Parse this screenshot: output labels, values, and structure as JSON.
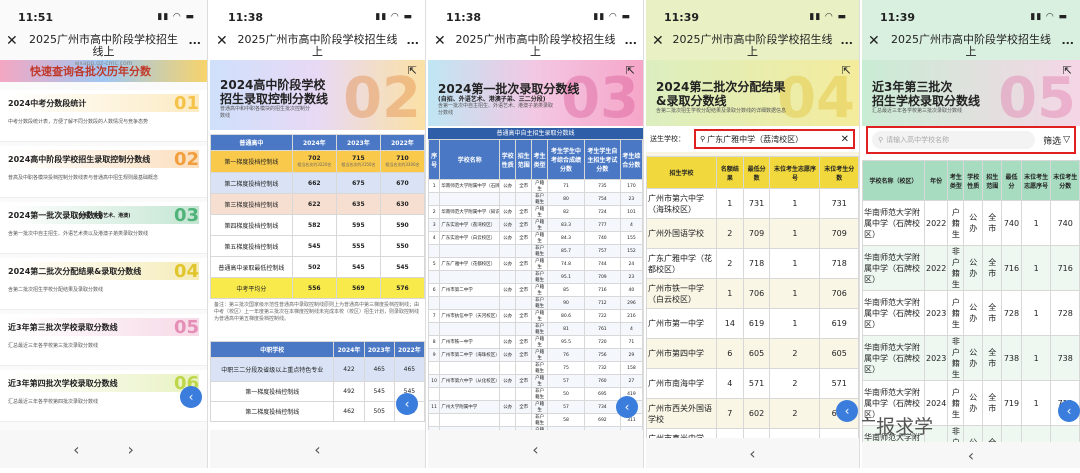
{
  "common": {
    "title": "2025广州市高中阶段学校招生线上",
    "domain": "wxapp.gz-cmc.com",
    "close": "✕",
    "more": "...",
    "signal": "▮▮ ◠ ▬",
    "prev": "‹",
    "next": "›",
    "fab": "‹"
  },
  "p1": {
    "time": "11:51",
    "banner": "快速查询各批次历年分数",
    "items": [
      {
        "title": "2024中考分数段统计",
        "num": "01",
        "desc": "中考分数段统计表，方便了解不同分数段的人数情况与竞争态势",
        "color": "#f6c34a"
      },
      {
        "title": "2024高中阶段学校招生录取控制分数线",
        "num": "02",
        "desc": "普高及中职各模块投档控制分数线表与普通高中招生规则最基础概念",
        "color": "#f29e3d"
      },
      {
        "title": "2024第一批次录取分数线",
        "title_small": "(自招、外语艺术、港澳)",
        "num": "03",
        "desc": "含第一批次中自主招生、外语艺术类以及港澳子弟类录取分数线",
        "color": "#4fb37a"
      },
      {
        "title": "2024第二批次分配结果&录取分数线",
        "num": "04",
        "desc": "含第二批次招生学校分配结果及录取分数线",
        "color": "#e1c52c"
      },
      {
        "title": "近3年第三批次学校录取分数线",
        "num": "05",
        "desc": "汇总最近三年各学校第三批次录取分数线",
        "color": "#e58fb7"
      },
      {
        "title": "近3年第四批次学校录取分数线",
        "num": "06",
        "desc": "汇总最近三年各学校第四批次录取分数线",
        "color": "#bcd74a"
      }
    ]
  },
  "p2": {
    "time": "11:38",
    "h1": "2024高中阶段学校",
    "h2": "招生录取控制分数线",
    "sub1": "普通高中和中职各模块的招生批次控制分",
    "sub2": "数线",
    "big": "02",
    "headers": [
      "普通高中",
      "2024年",
      "2023年",
      "2022年"
    ],
    "rows": [
      {
        "name": "第一梯度投档控制线",
        "v": [
          "702",
          "715",
          "710"
        ],
        "n": [
          "相当名次约3220名",
          "相当名次约3150名",
          "相当名次约3300名"
        ],
        "bg": "#f9c94c"
      },
      {
        "name": "第二梯度投档控制线",
        "v": [
          "662",
          "675",
          "670"
        ],
        "bg": "#d9e3f5"
      },
      {
        "name": "第三梯度投档控制线",
        "v": [
          "622",
          "635",
          "630"
        ],
        "bg": "#f6dfd0"
      },
      {
        "name": "第四梯度投档控制线",
        "v": [
          "582",
          "595",
          "590"
        ],
        "bg": "#fff"
      },
      {
        "name": "第五梯度投档控制线",
        "v": [
          "545",
          "555",
          "550"
        ],
        "bg": "#fff"
      },
      {
        "name": "普通高中录取最低控制线",
        "v": [
          "502",
          "545",
          "545"
        ],
        "bg": "#fff"
      },
      {
        "name": "中考平均分",
        "v": [
          "556",
          "569",
          "576"
        ],
        "bg": "#f9ea4c"
      }
    ],
    "note": "备注：第三批次国家级示范性普通高中录取控制线原则上为普通高中第三梯度投档控制线；由中考（校区）上一年度第三批次在本梯度控制线未完成本校（校区）招生计划，则录取控制线为普通高中第五梯度投档控制线。",
    "headers2": [
      "中职学校",
      "2024年",
      "2023年",
      "2022年"
    ],
    "rows2": [
      {
        "name": "中职三二分段及省级以上重点特色专业",
        "v": [
          "422",
          "465",
          "465"
        ]
      },
      {
        "name": "第一梯度投档控制线",
        "v": [
          "492",
          "545",
          "545"
        ]
      },
      {
        "name": "第二梯度投档控制线",
        "v": [
          "462",
          "505",
          "505"
        ]
      }
    ]
  },
  "p3": {
    "time": "11:38",
    "h1": "2024第一批次录取分数线",
    "sub1": "(自招、外语艺术、港澳子弟、三二分段)",
    "sub2": "含第一批次中自主招生、外语艺术、港澳子弟类录取",
    "sub3": "分数线",
    "big": "03",
    "table_title": "普通高中自主招生录取分数线",
    "headers": [
      "序号",
      "学校名称",
      "学校性质",
      "招生范围",
      "考生类型",
      "考生学生中考综合成绩分数",
      "考生学生自主招生考试分数",
      "考生综合分数"
    ],
    "rows": [
      [
        "1",
        "华南师范大学附属中学（石牌校区）",
        "公办",
        "全市",
        "户籍生",
        "71",
        "735",
        "170"
      ],
      [
        "",
        "",
        "",
        "",
        "非户籍生",
        "80",
        "754",
        "23"
      ],
      [
        "2",
        "华南师范大学附属中学（知识城校区）",
        "公办",
        "全市",
        "户籍生",
        "82",
        "724",
        "101"
      ],
      [
        "3",
        "广东实验中学（荔湾校区）",
        "公办",
        "全市",
        "户籍生",
        "83.3",
        "777",
        "4"
      ],
      [
        "4",
        "广东实验中学（白云校区）",
        "公办",
        "全市",
        "户籍生",
        "84.3",
        "740",
        "155"
      ],
      [
        "",
        "",
        "",
        "",
        "非户籍生",
        "85.7",
        "757",
        "152"
      ],
      [
        "5",
        "广东广雅中学（花都校区）",
        "公办",
        "全市",
        "户籍生",
        "74.8",
        "744",
        "24"
      ],
      [
        "",
        "",
        "",
        "",
        "非户籍生",
        "95.1",
        "709",
        "23"
      ],
      [
        "6",
        "广州市第二中学",
        "公办",
        "全市",
        "户籍生",
        "85",
        "716",
        "40"
      ],
      [
        "",
        "",
        "",
        "",
        "非户籍生",
        "90",
        "712",
        "296"
      ],
      [
        "7",
        "广州市执信中学（天河校区）",
        "公办",
        "全市",
        "户籍生",
        "80.6",
        "722",
        "216"
      ],
      [
        "",
        "",
        "",
        "",
        "非户籍生",
        "81",
        "761",
        "4"
      ],
      [
        "8",
        "广州市铁一中学",
        "公办",
        "全市",
        "户籍生",
        "95.5",
        "720",
        "71"
      ],
      [
        "9",
        "广州市第二中学（海珠校区）",
        "公办",
        "全市",
        "户籍生",
        "76",
        "756",
        "29"
      ],
      [
        "",
        "",
        "",
        "",
        "非户籍生",
        "75",
        "732",
        "158"
      ],
      [
        "10",
        "广州市第六中学（从化校区）",
        "公办",
        "全市",
        "户籍生",
        "57",
        "760",
        "27"
      ],
      [
        "",
        "",
        "",
        "",
        "非户籍生",
        "50",
        "695",
        "419"
      ],
      [
        "11",
        "广州大学附属中学",
        "公办",
        "全市",
        "户籍生",
        "57",
        "734",
        "110"
      ],
      [
        "",
        "",
        "",
        "",
        "非户籍生",
        "58",
        "692",
        "311"
      ],
      [
        "12",
        "广州市第四中学",
        "公办",
        "全市",
        "户籍生",
        "50",
        "720",
        "99"
      ],
      [
        "",
        "",
        "",
        "",
        "非户籍生",
        "83.4",
        "697",
        "163"
      ]
    ]
  },
  "p4": {
    "time": "11:39",
    "h1": "2024第二批次分配结果",
    "h2": "&录取分数线",
    "sub": "含第二批次招生学校分配结果及录取分数线的详细数据信息",
    "big": "04",
    "label": "送生学校：",
    "search_value": "广东广雅中学（荔湾校区）",
    "headers": [
      "招生学校",
      "名额结果",
      "最低分数",
      "末位考生志愿序号",
      "末位考生分数"
    ],
    "rows": [
      [
        "广州市第六中学（海珠校区）",
        "1",
        "731",
        "1",
        "731"
      ],
      [
        "广州外国语学校",
        "2",
        "709",
        "1",
        "709"
      ],
      [
        "广东广雅中学（花都校区）",
        "2",
        "718",
        "1",
        "718"
      ],
      [
        "广州市铁一中学（白云校区）",
        "1",
        "706",
        "1",
        "706"
      ],
      [
        "广州市第一中学",
        "14",
        "619",
        "1",
        "619"
      ],
      [
        "广州市第四中学",
        "6",
        "605",
        "2",
        "605"
      ],
      [
        "广州市南海中学",
        "4",
        "571",
        "2",
        "571"
      ],
      [
        "广州市西关外国语学校",
        "7",
        "602",
        "2",
        "604"
      ],
      [
        "广州市真光中学（校本部）",
        "8",
        "657",
        "1",
        "657"
      ]
    ]
  },
  "p5": {
    "time": "11:39",
    "h1": "近3年第三批次",
    "h2": "招生学校录取分数线",
    "sub": "汇总最近三年各学校第三批次录取分数线",
    "big": "05",
    "placeholder": "请输入高中学校名称",
    "filter": "筛选",
    "headers": [
      "学校名称（校区）",
      "年份",
      "考生类型",
      "学校性质",
      "招生范围",
      "最低分",
      "末位考生志愿序号",
      "末位考生分数"
    ],
    "rows": [
      [
        "华南师范大学附属中学（石牌校区）",
        "2022",
        "户籍生",
        "公办",
        "全市",
        "740",
        "1",
        "740"
      ],
      [
        "华南师范大学附属中学（石牌校区）",
        "2022",
        "非户籍生",
        "公办",
        "全市",
        "716",
        "1",
        "716"
      ],
      [
        "华南师范大学附属中学（石牌校区）",
        "2023",
        "户籍生",
        "公办",
        "全市",
        "728",
        "1",
        "728"
      ],
      [
        "华南师范大学附属中学（石牌校区）",
        "2023",
        "非户籍生",
        "公办",
        "全市",
        "738",
        "1",
        "738"
      ],
      [
        "华南师范大学附属中学（石牌校区）",
        "2024",
        "户籍生",
        "公办",
        "全市",
        "719",
        "1",
        "719"
      ],
      [
        "华南师范大学附属中学（石牌校区）",
        "2024",
        "非户籍生",
        "公办",
        "全市",
        "720",
        "1",
        "720"
      ]
    ],
    "watermark": "公众号 · 广报求学"
  }
}
